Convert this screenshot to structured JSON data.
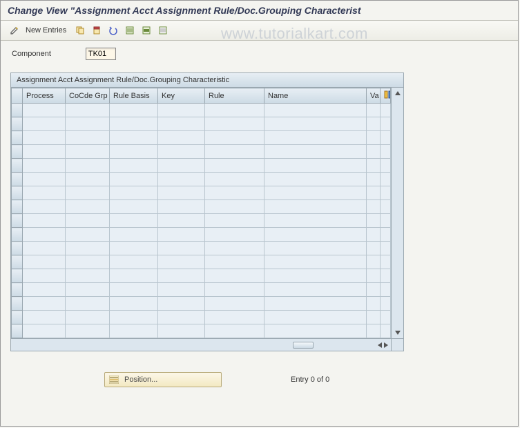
{
  "title": "Change View \"Assignment Acct Assignment Rule/Doc.Grouping Characterist",
  "watermark": "www.tutorialkart.com",
  "toolbar": {
    "new_entries": "New Entries"
  },
  "component": {
    "label": "Component",
    "value": "TK01"
  },
  "table": {
    "title": "Assignment Acct Assignment Rule/Doc.Grouping Characteristic",
    "columns": [
      "Process",
      "CoCde Grp",
      "Rule Basis",
      "Key",
      "Rule",
      "Name",
      "Va"
    ],
    "rows": []
  },
  "footer": {
    "position_label": "Position...",
    "entry_text": "Entry 0 of 0"
  }
}
